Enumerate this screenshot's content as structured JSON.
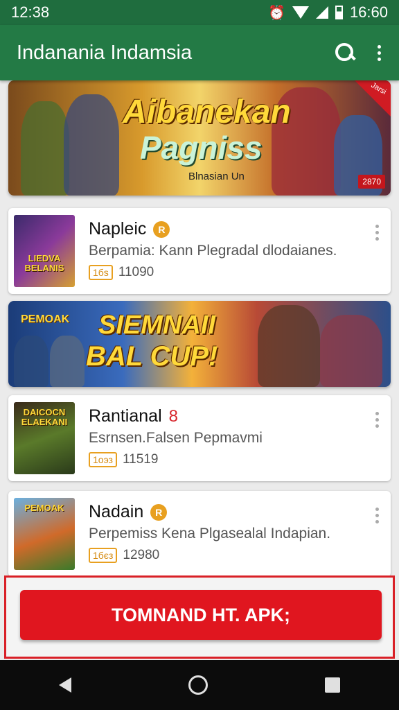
{
  "status_bar": {
    "time": "12:38",
    "clock_right": "16:60",
    "icons": [
      "alarm-icon",
      "wifi-icon",
      "signal-icon",
      "battery-icon"
    ]
  },
  "app_bar": {
    "title": "Indanania Indamsia",
    "icons": [
      "search-icon",
      "more-vert-icon"
    ]
  },
  "banner1": {
    "title_line1": "Aibanekan",
    "title_line2": "Pagniss",
    "subtitle": "Blnasian Un",
    "badge": "2870",
    "corner": "Jarsi"
  },
  "banner2": {
    "logo": "PEMOAK",
    "title_line1": "SIEMNAII",
    "title_line2": "BAL CUP!"
  },
  "apps": [
    {
      "title": "Napleic",
      "desc": "Berpamia: Kann Plegradal dlodaianes.",
      "badge": "1бѕ",
      "count": "11090",
      "thumb_text": "LIEDVA BELANIS",
      "mark": "R"
    },
    {
      "title": "Rantianal",
      "desc": "Esrnsen.Falsen Pepmavmi",
      "badge": "1оэз",
      "count": "11519",
      "thumb_text": "DAICOCN ELAEKANI",
      "mark": "8"
    },
    {
      "title": "Nadain",
      "desc": "Perpemiss Kena Plgasealal Indapian.",
      "badge": "1бєз",
      "count": "12980",
      "thumb_text": "PEMOAK",
      "mark": "R"
    }
  ],
  "cta": {
    "label": "TOMNAND HT. APK;"
  },
  "colors": {
    "status_bar": "#1f6d3e",
    "app_bar": "#237a45",
    "cta": "#e0161f",
    "cta_border": "#d92027"
  }
}
